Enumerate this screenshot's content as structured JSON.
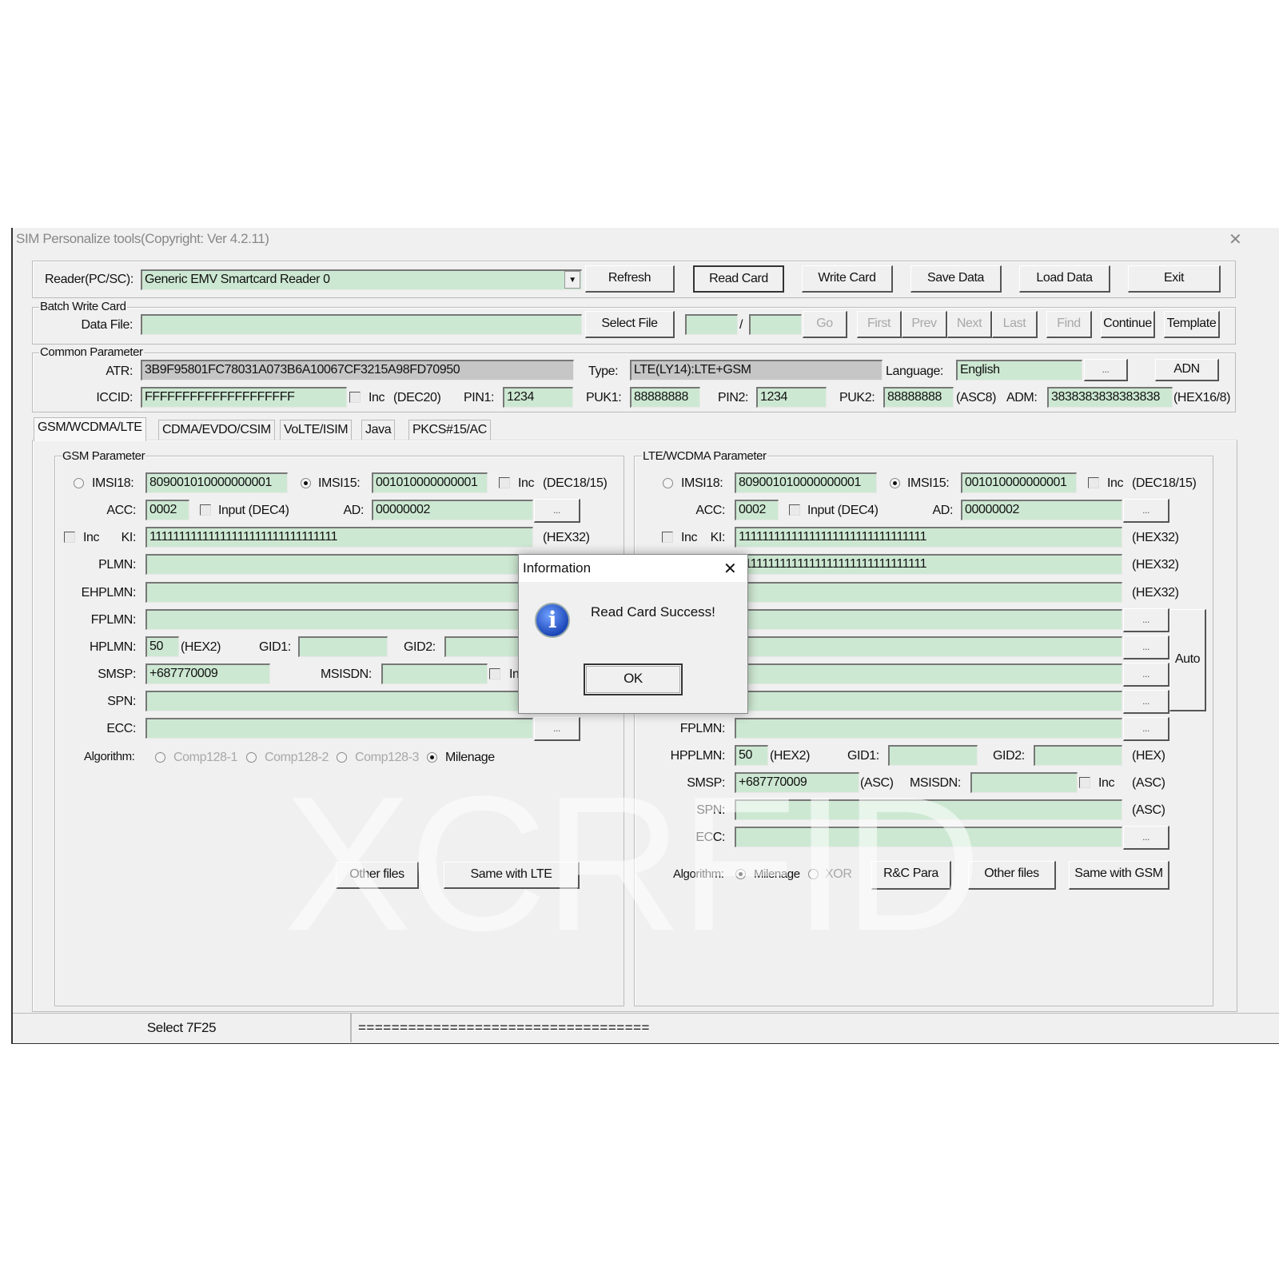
{
  "window": {
    "title": "SIM Personalize tools(Copyright: Ver 4.2.11)",
    "close": "✕"
  },
  "toolbar": {
    "reader_label": "Reader(PC/SC):",
    "reader_value": "Generic EMV Smartcard Reader 0",
    "refresh": "Refresh",
    "read_card": "Read Card",
    "write_card": "Write Card",
    "save_data": "Save Data",
    "load_data": "Load Data",
    "exit": "Exit"
  },
  "batch": {
    "title": "Batch Write Card",
    "data_file_label": "Data File:",
    "data_file_value": "",
    "select_file": "Select File",
    "from": "",
    "slash": "/",
    "to": "",
    "go": "Go",
    "first": "First",
    "prev": "Prev",
    "next": "Next",
    "last": "Last",
    "find": "Find",
    "continue": "Continue",
    "template": "Template"
  },
  "common": {
    "title": "Common Parameter",
    "atr_label": "ATR:",
    "atr": "3B9F95801FC78031A073B6A10067CF3215A98FD70950",
    "type_label": "Type:",
    "type": "LTE(LY14):LTE+GSM",
    "language_label": "Language:",
    "language": "English",
    "more": "...",
    "adn": "ADN",
    "iccid_label": "ICCID:",
    "iccid": "FFFFFFFFFFFFFFFFFFFF",
    "inc": "Inc",
    "dec20": "(DEC20)",
    "pin1_label": "PIN1:",
    "pin1": "1234",
    "puk1_label": "PUK1:",
    "puk1": "88888888",
    "pin2_label": "PIN2:",
    "pin2": "1234",
    "puk2_label": "PUK2:",
    "puk2": "88888888",
    "asc8": "(ASC8)",
    "adm_label": "ADM:",
    "adm": "3838383838383838",
    "hex168": "(HEX16/8)"
  },
  "tabs": [
    {
      "label": "GSM/WCDMA/LTE",
      "active": true
    },
    {
      "label": "CDMA/EVDO/CSIM"
    },
    {
      "label": "VoLTE/ISIM"
    },
    {
      "label": "Java"
    },
    {
      "label": "PKCS#15/AC"
    }
  ],
  "gsm": {
    "title": "GSM Parameter",
    "imsi18_label": "IMSI18:",
    "imsi18": "809001010000000001",
    "imsi15_label": "IMSI15:",
    "imsi15": "001010000000001",
    "inc": "Inc",
    "dec1815": "(DEC18/15)",
    "acc_label": "ACC:",
    "acc": "0002",
    "input_dec4": "Input (DEC4)",
    "ad_label": "AD:",
    "ad": "00000002",
    "more": "...",
    "ki_label": "KI:",
    "ki": "11111111111111111111111111111111",
    "hex32": "(HEX32)",
    "plmn_label": "PLMN:",
    "plmn": "",
    "ehplmn_label": "EHPLMN:",
    "ehplmn": "",
    "fplmn_label": "FPLMN:",
    "fplmn": "",
    "hplmn_label": "HPLMN:",
    "hplmn": "50",
    "hex2": "(HEX2)",
    "gid1_label": "GID1:",
    "gid1": "",
    "gid2_label": "GID2:",
    "gid2": "",
    "smsp_label": "SMSP:",
    "smsp": "+687770009",
    "msisdn_label": "MSISDN:",
    "msisdn": "",
    "spn_label": "SPN:",
    "spn": "",
    "ecc_label": "ECC:",
    "ecc": "",
    "algorithm_label": "Algorithm:",
    "algos": [
      "Comp128-1",
      "Comp128-2",
      "Comp128-3",
      "Milenage"
    ],
    "algo_selected": "Milenage",
    "other_files": "Other files",
    "same_with_lte": "Same with LTE"
  },
  "lte": {
    "title": "LTE/WCDMA Parameter",
    "imsi18_label": "IMSI18:",
    "imsi18": "809001010000000001",
    "imsi15_label": "IMSI15:",
    "imsi15": "001010000000001",
    "inc": "Inc",
    "dec1815": "(DEC18/15)",
    "acc_label": "ACC:",
    "acc": "0002",
    "input_dec4": "Input (DEC4)",
    "ad_label": "AD:",
    "ad": "00000002",
    "more": "...",
    "ki_label": "KI:",
    "ki": "11111111111111111111111111111111",
    "hex32": "(HEX32)",
    "row4": "11111111111111111111111111111111",
    "auto": "Auto",
    "fplmn_label": "FPLMN:",
    "hpplmn_label": "HPPLMN:",
    "hpplmn": "50",
    "hex2": "(HEX2)",
    "gid1_label": "GID1:",
    "gid2_label": "GID2:",
    "hex": "(HEX)",
    "smsp_label": "SMSP:",
    "smsp": "+687770009",
    "asc": "(ASC)",
    "msisdn_label": "MSISDN:",
    "spn_label": "SPN:",
    "ecc_label": "ECC:",
    "algorithm_label": "Algorithm:",
    "milenage": "Milenage",
    "xor": "XOR",
    "algo_selected": "Milenage",
    "rc_para": "R&C Para",
    "other_files": "Other files",
    "same_with_gsm": "Same with GSM"
  },
  "dialog": {
    "title": "Information",
    "close": "✕",
    "message": "Read Card Success!",
    "ok": "OK",
    "icon": "info-icon"
  },
  "status": {
    "left": "Select 7F25",
    "right": "==================================="
  },
  "watermark": "XCRFID"
}
